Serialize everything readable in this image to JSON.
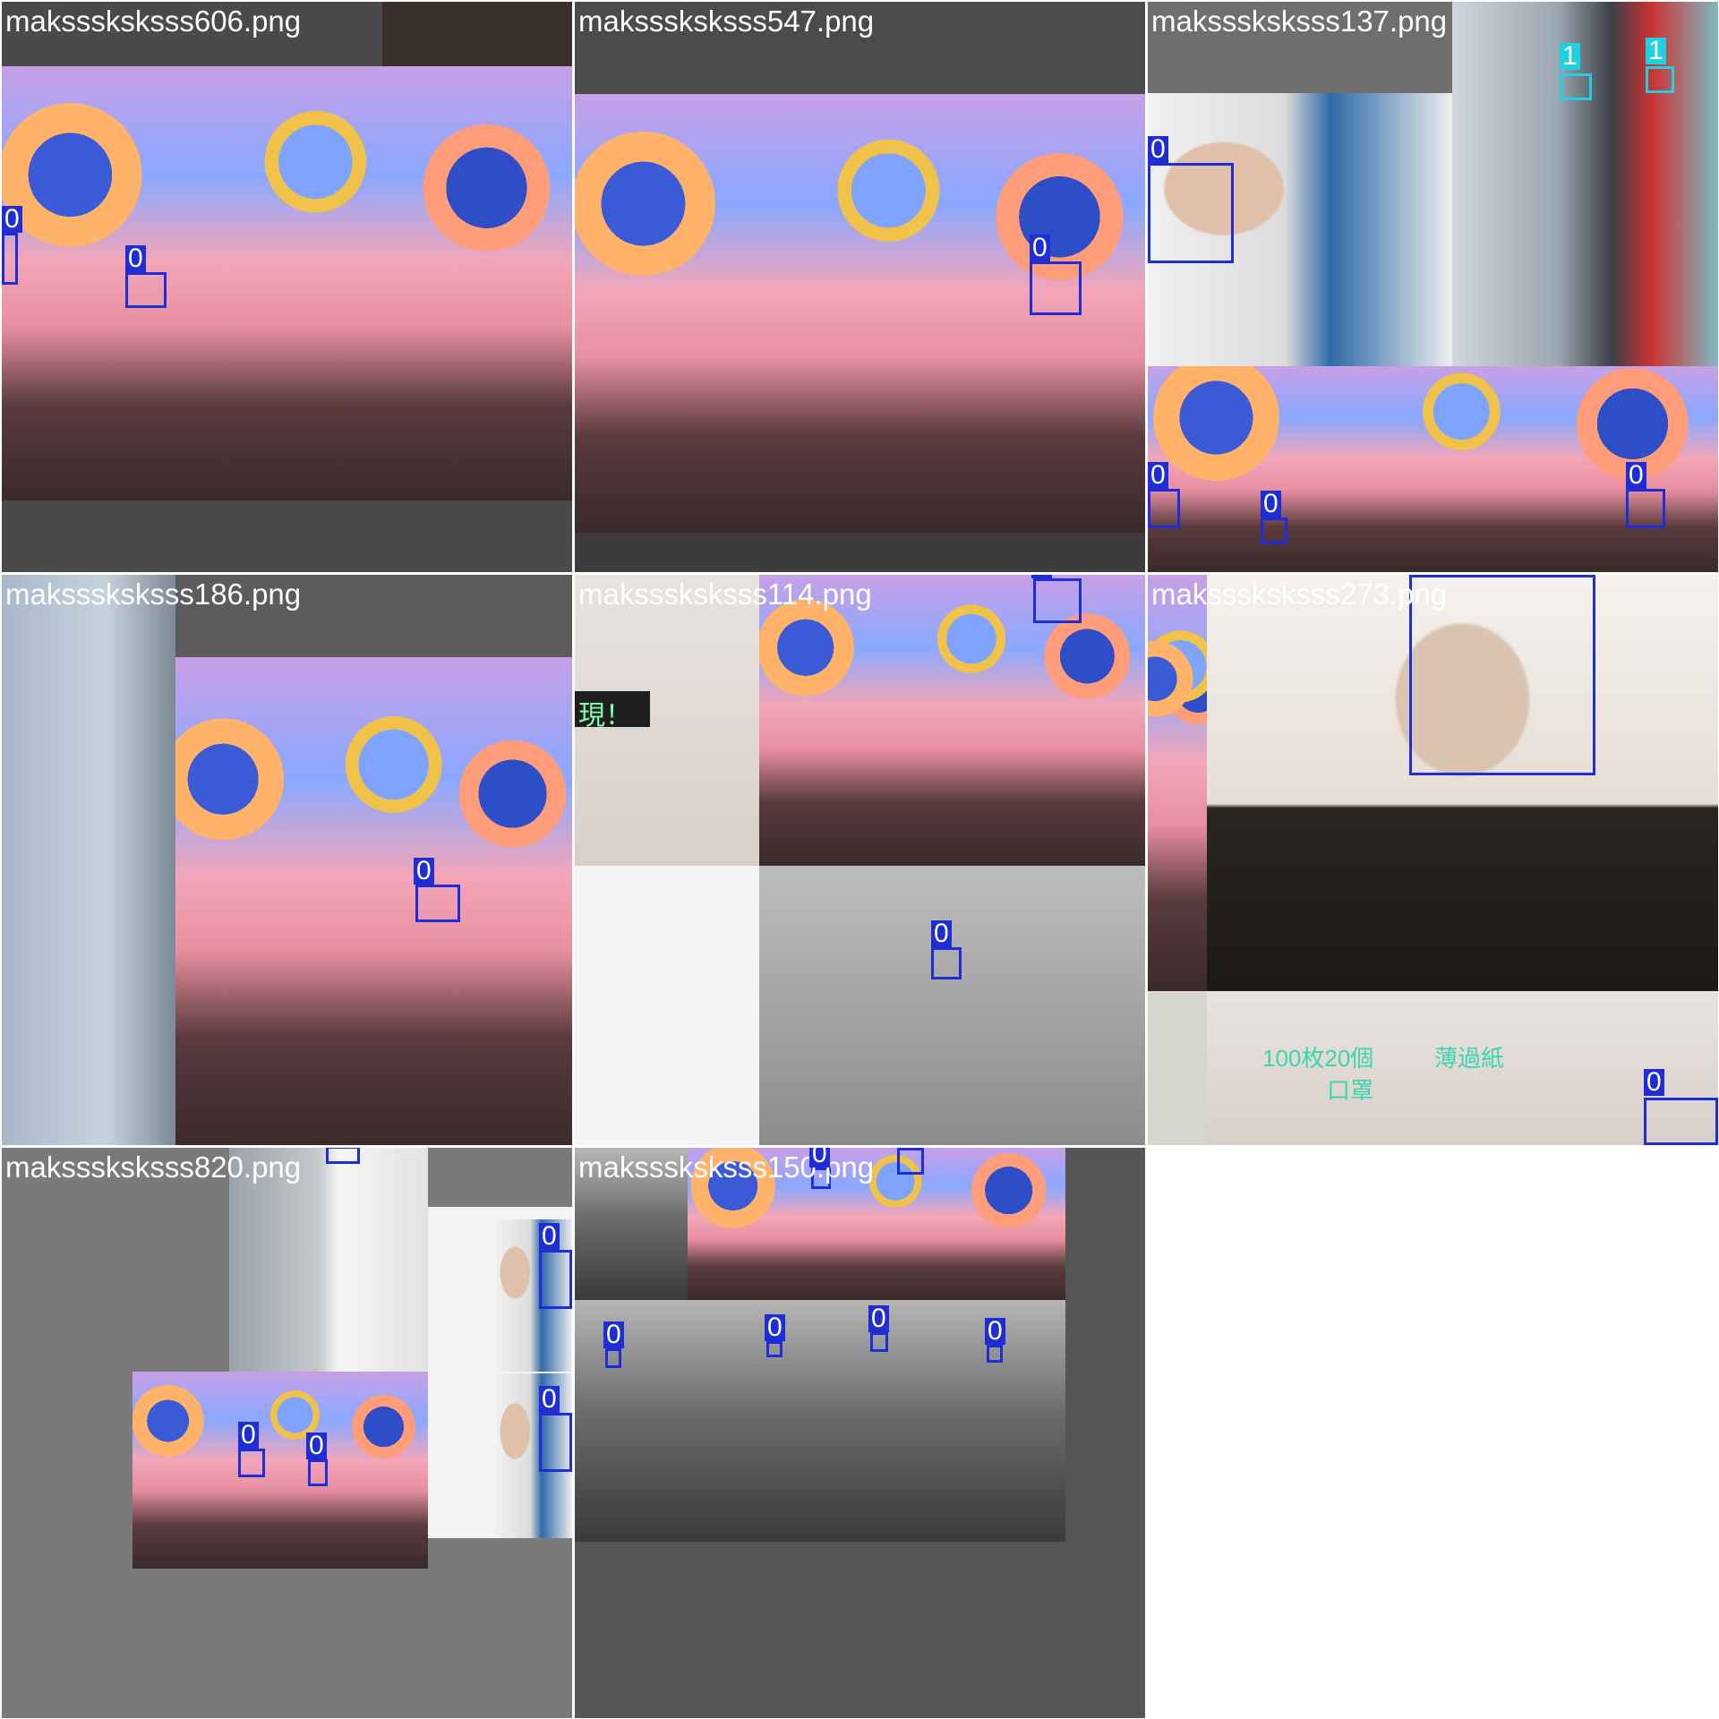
{
  "tiles": [
    {
      "filename": "maksssksksss606.png"
    },
    {
      "filename": "maksssksksss547.png"
    },
    {
      "filename": "maksssksksss137.png"
    },
    {
      "filename": "maksssksksss186.png"
    },
    {
      "filename": "maksssksksss114.png"
    },
    {
      "filename": "maksssksksss273.png"
    },
    {
      "filename": "maksssksksss820.png"
    },
    {
      "filename": "maksssksksss150.png"
    }
  ],
  "labels": {
    "class0": "0",
    "class1": "1"
  },
  "colors": {
    "class0": "#1f2dd6",
    "class1": "#1fd0e0"
  },
  "overlay_text": {
    "sign": "現！",
    "caption_right": "薄過紙",
    "caption_mid": "100枚20個",
    "caption_low": "口罩"
  }
}
